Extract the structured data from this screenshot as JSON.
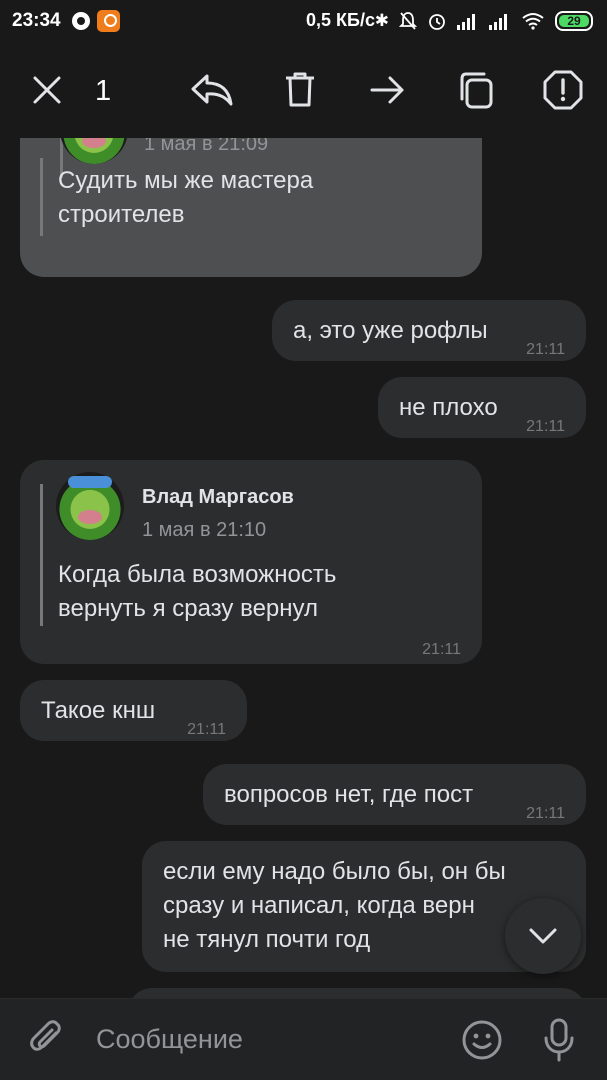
{
  "status_bar": {
    "time": "23:34",
    "speed": "0,5 КБ/с",
    "battery": "29",
    "icons": [
      "chat-notification-icon",
      "ok-app-icon",
      "bluetooth-icon",
      "mute-icon",
      "alarm-icon",
      "signal-icon",
      "signal-icon",
      "wifi-icon",
      "battery-icon"
    ]
  },
  "toolbar": {
    "selected_count": "1",
    "actions": [
      "close-icon",
      "reply-icon",
      "delete-icon",
      "forward-icon",
      "copy-icon",
      "report-icon"
    ]
  },
  "messages": [
    {
      "id": "m1",
      "direction": "incoming",
      "selected": true,
      "forwarded": {
        "date": "1 мая в 21:09",
        "text_line1": "Судить мы же мастера",
        "text_line2": "строителев"
      }
    },
    {
      "id": "m2",
      "direction": "outgoing",
      "text": "а, это уже рофлы",
      "time": "21:11"
    },
    {
      "id": "m3",
      "direction": "outgoing",
      "text": "не плохо",
      "time": "21:11"
    },
    {
      "id": "m4",
      "direction": "incoming",
      "forwarded": {
        "author": "Влад Маргасов",
        "date": "1 мая в 21:10",
        "text_line1": "Когда была возможность",
        "text_line2": "вернуть я сразу вернул"
      },
      "time": "21:11"
    },
    {
      "id": "m5",
      "direction": "incoming",
      "text": "Такое кнш",
      "time": "21:11"
    },
    {
      "id": "m6",
      "direction": "outgoing",
      "text": "вопросов нет, где пост",
      "time": "21:11"
    },
    {
      "id": "m7",
      "direction": "outgoing",
      "text_line1": "если ему надо было бы, он бы",
      "text_line2": "сразу и написал, когда верн",
      "text_line3": "не тянул почти год"
    }
  ],
  "composer": {
    "placeholder": "Сообщение"
  },
  "colors": {
    "background": "#19191a",
    "bubble": "#2c2d2e",
    "bubble_selected": "#4e4f51",
    "time_text": "#76787a",
    "accent_ok": "#f07d1c",
    "battery": "#4cd964"
  }
}
